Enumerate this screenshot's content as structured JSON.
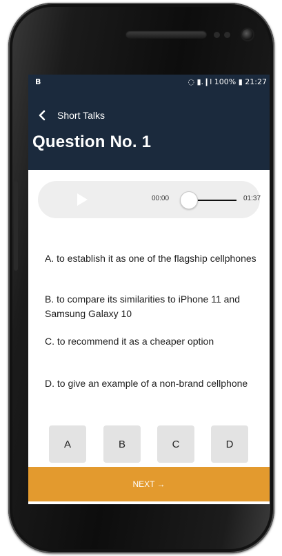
{
  "status_bar": {
    "notification_icon": "B",
    "right_text": "⦿ 📶 .∣l 100% ▮ 21:27",
    "time": "21:27",
    "battery": "100%"
  },
  "header": {
    "back_label": "Short Talks",
    "title": "Question No. 1"
  },
  "player": {
    "current_time": "00:00",
    "duration": "01:37",
    "progress_fraction": 0
  },
  "options": [
    "A. to establish it as one of the flagship cellphones",
    "B. to compare its similarities to iPhone 11 and Samsung Galaxy 10",
    "C. to recommend it as a cheaper option",
    "D. to give an example of a non-brand cellphone"
  ],
  "answer_buttons": [
    "A",
    "B",
    "C",
    "D"
  ],
  "next_label": "NEXT →",
  "colors": {
    "header_bg": "#1b2a3d",
    "next_bg": "#e39a2e",
    "player_bg": "#eeeeee",
    "button_bg": "#e3e3e3"
  }
}
